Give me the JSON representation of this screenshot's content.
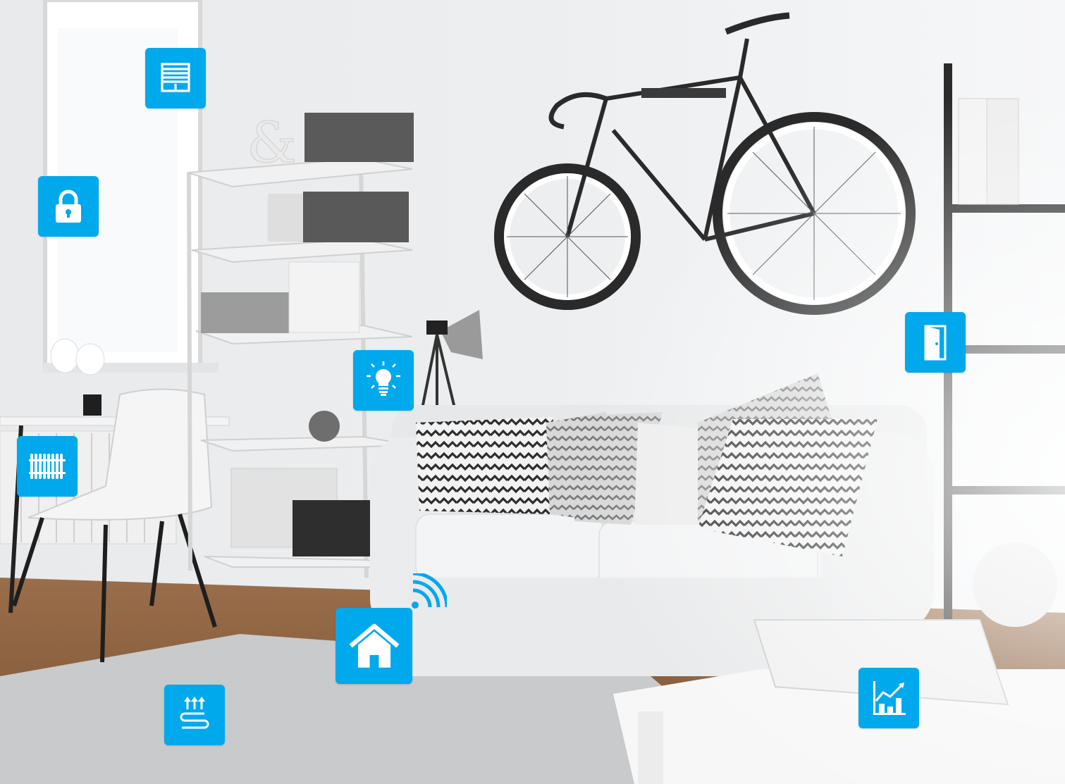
{
  "scene": {
    "description_icons": [
      "blinds-icon",
      "lock-icon",
      "lightbulb-icon",
      "door-icon",
      "radiator-icon",
      "smart-home-icon",
      "wifi-icon",
      "floor-heating-icon",
      "statistics-icon"
    ]
  },
  "colors": {
    "accent": "#00a8ec",
    "icon_fg": "#ffffff",
    "wall": "#eceef0",
    "floor": "#8a5f3e",
    "rug": "#c9cbcd",
    "sofa": "#e6e7e8",
    "dark": "#2a2a2a"
  }
}
